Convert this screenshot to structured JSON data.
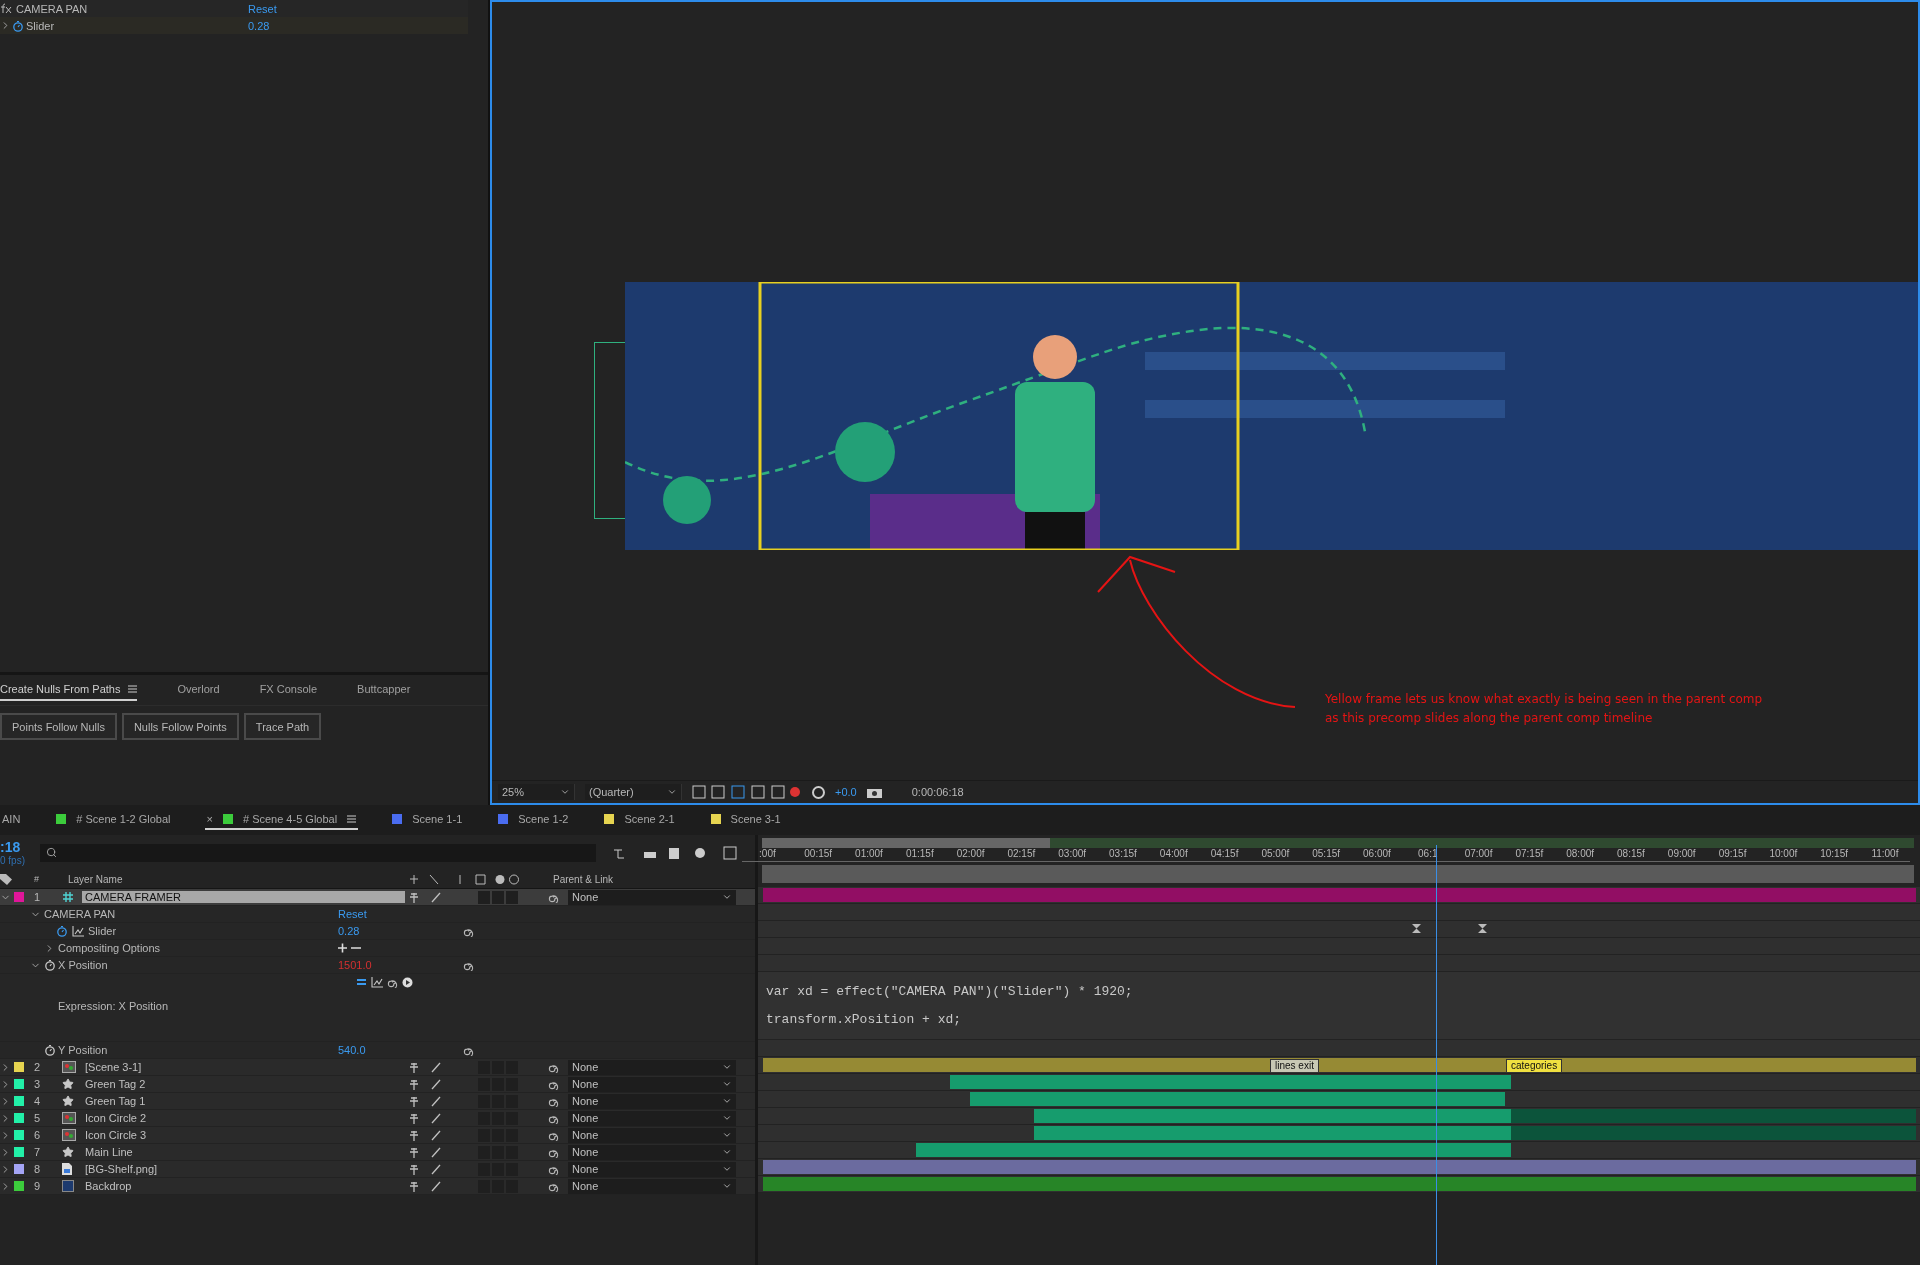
{
  "effect_controls": {
    "effect": {
      "name": "CAMERA PAN",
      "action": "Reset"
    },
    "properties": [
      {
        "name": "Slider",
        "value": "0.28",
        "expanded": false
      }
    ]
  },
  "script_panel": {
    "tabs": [
      {
        "label": "Create Nulls From Paths",
        "selected": true
      },
      {
        "label": "Overlord",
        "selected": false
      },
      {
        "label": "FX Console",
        "selected": false
      },
      {
        "label": "Buttcapper",
        "selected": false
      }
    ],
    "buttons": [
      "Points Follow Nulls",
      "Nulls Follow Points",
      "Trace Path"
    ]
  },
  "viewer": {
    "annotation": [
      "Yellow frame lets us know what exactly is being seen in the parent comp",
      "as this precomp slides along the parent comp timeline"
    ],
    "toolbar": {
      "zoom": "25%",
      "resolution": "(Quarter)",
      "exposure": "+0.0",
      "timecode": "0:00:06:18"
    }
  },
  "comp_tabs": [
    {
      "label": "AIN",
      "selected": false
    },
    {
      "label": "# Scene 1-2 Global",
      "color": "#3ccc3c",
      "selected": false
    },
    {
      "label": "# Scene 4-5 Global",
      "color": "#3ccc3c",
      "selected": true,
      "close": "×"
    },
    {
      "label": "Scene 1-1",
      "color": "#4a6cf0",
      "selected": false
    },
    {
      "label": "Scene 1-2",
      "color": "#4a6cf0",
      "selected": false
    },
    {
      "label": "Scene 2-1",
      "color": "#e6d450",
      "selected": false
    },
    {
      "label": "Scene 3-1",
      "color": "#e6d450",
      "selected": false
    }
  ],
  "timeline": {
    "timecode": ":18",
    "fps": "0 fps)",
    "columns": [
      "#",
      "Layer Name",
      "Parent & Link"
    ],
    "ruler": [
      ":00f",
      "00:15f",
      "01:00f",
      "01:15f",
      "02:00f",
      "02:15f",
      "03:00f",
      "03:15f",
      "04:00f",
      "04:15f",
      "05:00f",
      "05:15f",
      "06:00f",
      "06:1",
      "07:00f",
      "07:15f",
      "08:00f",
      "08:15f",
      "09:00f",
      "09:15f",
      "10:00f",
      "10:15f",
      "11:00f"
    ],
    "layers": [
      {
        "number": "1",
        "name": "CAMERA FRAMER",
        "color": "#e0169a",
        "kind": "shape",
        "selected": true,
        "expanded": true,
        "parent": "None",
        "properties": [
          {
            "kind": "effect",
            "name": "CAMERA PAN",
            "value": "Reset",
            "expanded": true
          },
          {
            "kind": "slider",
            "name": "Slider",
            "value": "0.28"
          },
          {
            "kind": "group",
            "name": "Compositing Options",
            "expanded": false
          },
          {
            "kind": "expression_prop",
            "name": "X Position",
            "value": "1501.0",
            "expanded": true
          },
          {
            "kind": "expression",
            "label": "Expression: X Position",
            "code": [
              "var xd = effect(\"CAMERA PAN\")(\"Slider\") * 1920;",
              "transform.xPosition + xd;"
            ]
          },
          {
            "kind": "prop",
            "name": "Y Position",
            "value": "540.0"
          }
        ]
      },
      {
        "number": "2",
        "name": "[Scene 3-1]",
        "color": "#e6d450",
        "kind": "precomp",
        "selected": false,
        "expanded": false,
        "parent": "None",
        "markers": [
          {
            "label": "lines exit",
            "color": "#c8c8b4"
          },
          {
            "label": "categories",
            "color": "#f0e040"
          }
        ]
      },
      {
        "number": "3",
        "name": "Green Tag 2",
        "color": "#22f0a8",
        "kind": "star",
        "selected": false,
        "expanded": false,
        "parent": "None"
      },
      {
        "number": "4",
        "name": "Green Tag 1",
        "color": "#22f0a8",
        "kind": "star",
        "selected": false,
        "expanded": false,
        "parent": "None"
      },
      {
        "number": "5",
        "name": "Icon Circle 2",
        "color": "#22f0a8",
        "kind": "precomp",
        "selected": false,
        "expanded": false,
        "parent": "None"
      },
      {
        "number": "6",
        "name": "Icon Circle 3",
        "color": "#22f0a8",
        "kind": "precomp",
        "selected": false,
        "expanded": false,
        "parent": "None"
      },
      {
        "number": "7",
        "name": "Main Line",
        "color": "#22f0a8",
        "kind": "star",
        "selected": false,
        "expanded": false,
        "parent": "None"
      },
      {
        "number": "8",
        "name": "[BG-Shelf.png]",
        "color": "#a4a4f5",
        "kind": "footage",
        "selected": false,
        "expanded": false,
        "parent": "None"
      },
      {
        "number": "9",
        "name": "Backdrop",
        "color": "#3ccc3c",
        "kind": "solid",
        "selected": false,
        "expanded": false,
        "parent": "None"
      }
    ]
  }
}
